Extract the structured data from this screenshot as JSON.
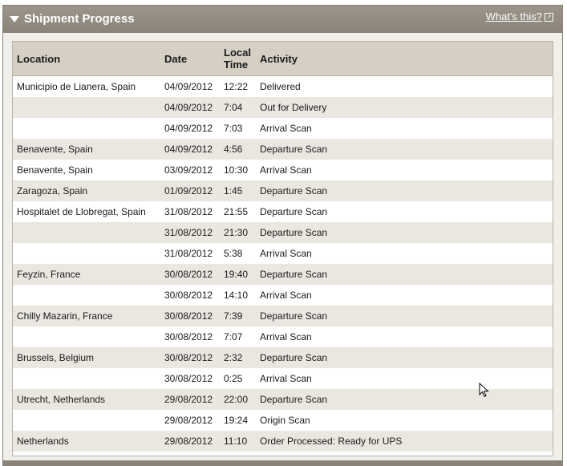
{
  "header": {
    "title": "Shipment Progress",
    "help_link": "What's this?",
    "help_icon": "external-link-icon",
    "collapse_icon": "triangle-down-icon"
  },
  "table": {
    "columns": {
      "location": "Location",
      "date": "Date",
      "time_line1": "Local",
      "time_line2": "Time",
      "activity": "Activity"
    },
    "rows": [
      {
        "location": "Municipio de Lianera, Spain",
        "date": "04/09/2012",
        "time": "12:22",
        "activity": "Delivered"
      },
      {
        "location": "",
        "date": "04/09/2012",
        "time": "7:04",
        "activity": "Out for Delivery"
      },
      {
        "location": "",
        "date": "04/09/2012",
        "time": "7:03",
        "activity": "Arrival Scan"
      },
      {
        "location": "Benavente, Spain",
        "date": "04/09/2012",
        "time": "4:56",
        "activity": "Departure Scan"
      },
      {
        "location": "Benavente, Spain",
        "date": "03/09/2012",
        "time": "10:30",
        "activity": "Arrival Scan"
      },
      {
        "location": "Zaragoza, Spain",
        "date": "01/09/2012",
        "time": "1:45",
        "activity": "Departure Scan"
      },
      {
        "location": "Hospitalet de Llobregat, Spain",
        "date": "31/08/2012",
        "time": "21:55",
        "activity": "Departure Scan"
      },
      {
        "location": "",
        "date": "31/08/2012",
        "time": "21:30",
        "activity": "Departure Scan"
      },
      {
        "location": "",
        "date": "31/08/2012",
        "time": "5:38",
        "activity": "Arrival Scan"
      },
      {
        "location": "Feyzin, France",
        "date": "30/08/2012",
        "time": "19:40",
        "activity": "Departure Scan"
      },
      {
        "location": "",
        "date": "30/08/2012",
        "time": "14:10",
        "activity": "Arrival Scan"
      },
      {
        "location": "Chilly Mazarin, France",
        "date": "30/08/2012",
        "time": "7:39",
        "activity": "Departure Scan"
      },
      {
        "location": "",
        "date": "30/08/2012",
        "time": "7:07",
        "activity": "Arrival Scan"
      },
      {
        "location": "Brussels, Belgium",
        "date": "30/08/2012",
        "time": "2:32",
        "activity": "Departure Scan"
      },
      {
        "location": "",
        "date": "30/08/2012",
        "time": "0:25",
        "activity": "Arrival Scan"
      },
      {
        "location": "Utrecht, Netherlands",
        "date": "29/08/2012",
        "time": "22:00",
        "activity": "Departure Scan"
      },
      {
        "location": "",
        "date": "29/08/2012",
        "time": "19:24",
        "activity": "Origin Scan"
      },
      {
        "location": "Netherlands",
        "date": "29/08/2012",
        "time": "11:10",
        "activity": "Order Processed: Ready for UPS"
      }
    ]
  },
  "colors": {
    "header_bg": "#8a8478",
    "table_header_bg": "#d5d0c3",
    "row_alt_bg": "#e9e7e0"
  },
  "cursor_icon": "mouse-pointer-icon"
}
